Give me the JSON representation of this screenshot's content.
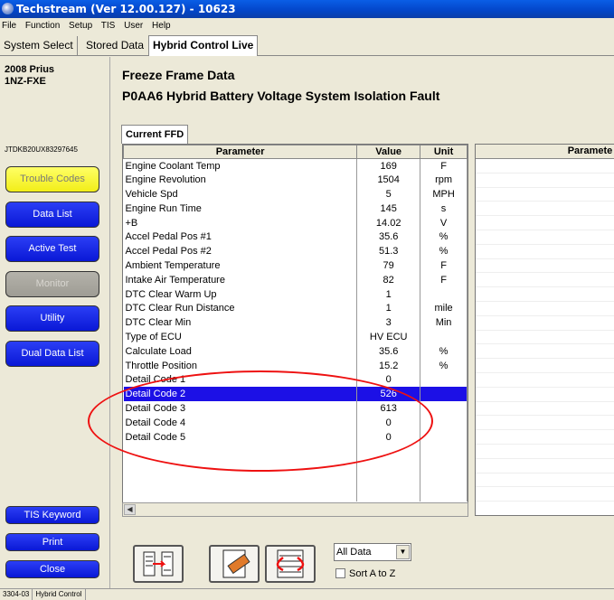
{
  "window": {
    "title": "Techstream (Ver 12.00.127) - 10623"
  },
  "menu": [
    "File",
    "Function",
    "Setup",
    "TIS",
    "User",
    "Help"
  ],
  "tabs": [
    "System Select",
    "Stored Data",
    "Hybrid Control Live"
  ],
  "vehicle": {
    "model": "2008 Prius",
    "engine": "1NZ-FXE",
    "vin": "JTDKB20UX83297645"
  },
  "nav": {
    "trouble_codes": "Trouble Codes",
    "data_list": "Data List",
    "active_test": "Active Test",
    "monitor": "Monitor",
    "utility": "Utility",
    "dual_data_list": "Dual Data List",
    "tis_keyword": "TIS Keyword",
    "print": "Print",
    "close": "Close"
  },
  "main": {
    "heading": "Freeze Frame Data",
    "fault": "P0AA6 Hybrid Battery Voltage System Isolation Fault",
    "ffd_tab": "Current FFD",
    "headers": {
      "parameter": "Parameter",
      "value": "Value",
      "unit": "Unit"
    },
    "rows": [
      {
        "p": "Engine Coolant Temp",
        "v": "169",
        "u": "F"
      },
      {
        "p": "Engine Revolution",
        "v": "1504",
        "u": "rpm"
      },
      {
        "p": "Vehicle Spd",
        "v": "5",
        "u": "MPH"
      },
      {
        "p": "Engine Run Time",
        "v": "145",
        "u": "s"
      },
      {
        "p": "+B",
        "v": "14.02",
        "u": "V"
      },
      {
        "p": "Accel Pedal Pos #1",
        "v": "35.6",
        "u": "%"
      },
      {
        "p": "Accel Pedal Pos #2",
        "v": "51.3",
        "u": "%"
      },
      {
        "p": "Ambient Temperature",
        "v": "79",
        "u": "F"
      },
      {
        "p": "Intake Air Temperature",
        "v": "82",
        "u": "F"
      },
      {
        "p": "DTC Clear Warm Up",
        "v": "1",
        "u": ""
      },
      {
        "p": "DTC Clear Run Distance",
        "v": "1",
        "u": "mile"
      },
      {
        "p": "DTC Clear Min",
        "v": "3",
        "u": "Min"
      },
      {
        "p": "Type of ECU",
        "v": "HV ECU",
        "u": ""
      },
      {
        "p": "Calculate Load",
        "v": "35.6",
        "u": "%"
      },
      {
        "p": "Throttle Position",
        "v": "15.2",
        "u": "%"
      },
      {
        "p": "Detail Code 1",
        "v": "0",
        "u": ""
      },
      {
        "p": "Detail Code 2",
        "v": "526",
        "u": ""
      },
      {
        "p": "Detail Code 3",
        "v": "613",
        "u": ""
      },
      {
        "p": "Detail Code 4",
        "v": "0",
        "u": ""
      },
      {
        "p": "Detail Code 5",
        "v": "0",
        "u": ""
      }
    ],
    "selected_row": 16,
    "second_table_header": "Paramete"
  },
  "controls": {
    "filter_value": "All Data",
    "sort_label": "Sort A to Z"
  },
  "status": [
    "3304-03",
    "Hybrid Control"
  ],
  "colors": {
    "selection": "#1c10e6",
    "nav_blue": "#0a18d6",
    "highlight_yellow": "#f2ee18",
    "annotation_red": "#e11111"
  }
}
